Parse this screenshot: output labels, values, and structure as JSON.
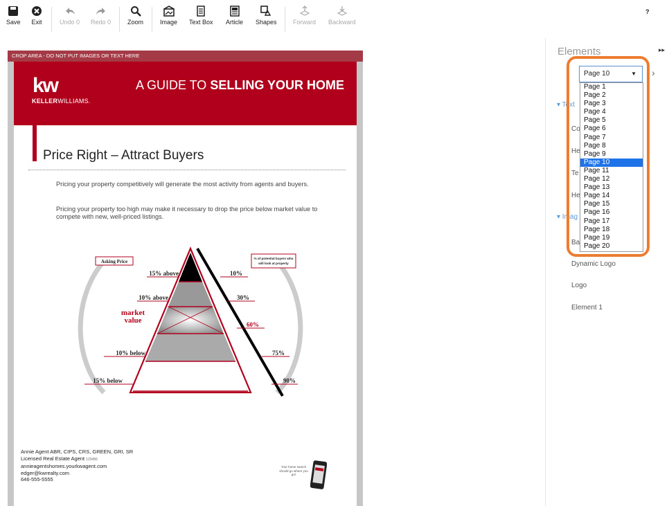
{
  "toolbar": {
    "save": "Save",
    "exit": "Exit",
    "undo": "Undo 0",
    "redo": "Redo 0",
    "zoom": "Zoom",
    "image": "Image",
    "textbox": "Text Box",
    "article": "Article",
    "shapes": "Shapes",
    "forward": "Forward",
    "backward": "Backward",
    "help": "?"
  },
  "document": {
    "crop_note": "CROP AREA - DO NOT PUT IMAGES OR TEXT HERE",
    "brand_mark": "kw",
    "brand_name_bold": "KELLER",
    "brand_name_rest": "WILLIAMS.",
    "header_title_a": "A GUIDE TO ",
    "header_title_b": "SELLING YOUR HOME",
    "section_title": "Price Right – Attract Buyers",
    "para1": "Pricing your property competitively will generate the most activity from agents and buyers.",
    "para2": "Pricing your property too high may make it necessary to drop the price below market value to compete with new, well-priced listings.",
    "chart": {
      "asking_label": "Asking Price",
      "buyers_label_1": "% of potential buyers who",
      "buyers_label_2": "will look at property",
      "market_1": "market",
      "market_2": "value",
      "rows": [
        {
          "left": "15% above",
          "right": "10%"
        },
        {
          "left": "10% above",
          "right": "30%"
        },
        {
          "left": "",
          "right": "60%"
        },
        {
          "left": "10% below",
          "right": "75%"
        },
        {
          "left": "15% below",
          "right": "90%"
        }
      ]
    },
    "agent": {
      "line1": "Annie Agent ABR, CIPS, CRS, GREEN, GRI, SR",
      "line2": "Licensed Real Estate Agent",
      "line2_small": "123456",
      "line3": "annieagentshomes.yourkwagent.com",
      "line4": "edger@kwrealty.com",
      "line5": "646-555-5555"
    },
    "phone_tagline": "Your home search should go where you go!"
  },
  "panel": {
    "title": "Elements",
    "collapse": "▸▸",
    "selected_page": "Page 10",
    "next": "›",
    "text_section": "▾ Text",
    "text_items": [
      "Co",
      "He",
      "Te",
      "He"
    ],
    "image_section": "▾ Imag",
    "image_items": [
      "Ba",
      "Dynamic Logo",
      "Logo",
      "Element 1"
    ],
    "pages": [
      "Page 1",
      "Page 2",
      "Page 3",
      "Page 4",
      "Page 5",
      "Page 6",
      "Page 7",
      "Page 8",
      "Page 9",
      "Page 10",
      "Page 11",
      "Page 12",
      "Page 13",
      "Page 14",
      "Page 15",
      "Page 16",
      "Page 17",
      "Page 18",
      "Page 19",
      "Page 20"
    ]
  }
}
